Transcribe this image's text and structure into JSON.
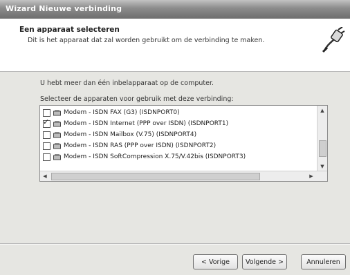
{
  "window": {
    "title": "Wizard Nieuwe verbinding"
  },
  "header": {
    "title": "Een apparaat selecteren",
    "subtitle": "Dit is het apparaat dat zal worden gebruikt om de verbinding te maken."
  },
  "content": {
    "intro": "U hebt meer dan één inbelapparaat op de computer.",
    "select_label": "Selecteer de apparaten voor gebruik met deze verbinding:",
    "devices": [
      {
        "label": "Modem - ISDN FAX (G3) (ISDNPORT0)",
        "checked": false
      },
      {
        "label": "Modem - ISDN Internet (PPP over ISDN) (ISDNPORT1)",
        "checked": true
      },
      {
        "label": "Modem - ISDN Mailbox (V.75) (ISDNPORT4)",
        "checked": false
      },
      {
        "label": "Modem - ISDN RAS (PPP over ISDN) (ISDNPORT2)",
        "checked": false
      },
      {
        "label": "Modem - ISDN SoftCompression X.75/V.42bis (ISDNPORT3)",
        "checked": false
      }
    ]
  },
  "buttons": {
    "back": "< Vorige",
    "next": "Volgende >",
    "cancel": "Annuleren"
  },
  "icons": {
    "wizard": "plug-cable-icon",
    "device": "modem-icon",
    "checkmark": "check-icon"
  }
}
